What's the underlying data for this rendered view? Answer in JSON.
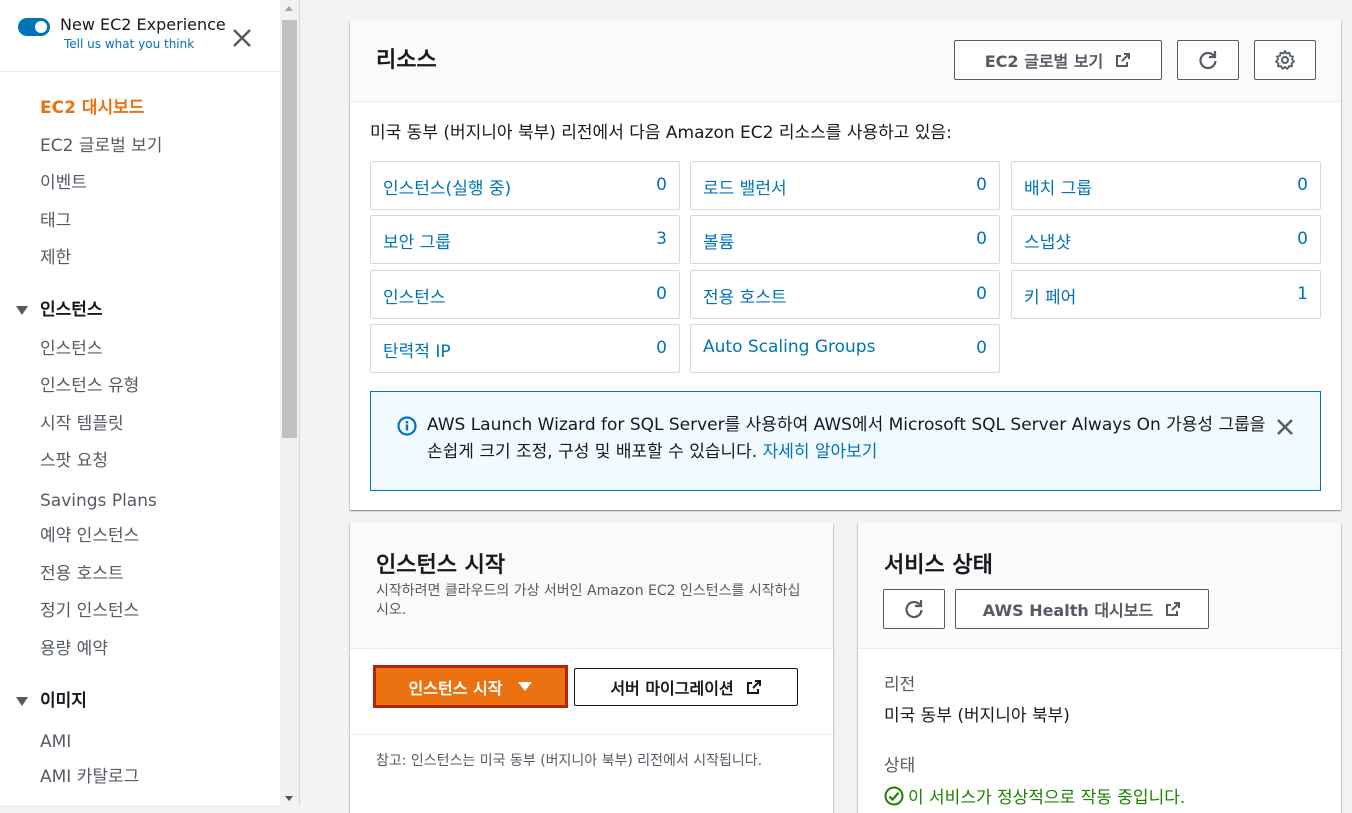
{
  "sidebar": {
    "toggle_title": "New EC2 Experience",
    "toggle_sub": "Tell us what you think",
    "items": [
      {
        "label": "EC2 대시보드"
      },
      {
        "label": "EC2 글로벌 보기"
      },
      {
        "label": "이벤트"
      },
      {
        "label": "태그"
      },
      {
        "label": "제한"
      }
    ],
    "section_instances": "인스턴스",
    "instance_items": [
      {
        "label": "인스턴스"
      },
      {
        "label": "인스턴스 유형"
      },
      {
        "label": "시작 템플릿"
      },
      {
        "label": "스팟 요청"
      },
      {
        "label": "Savings Plans"
      },
      {
        "label": "예약 인스턴스"
      },
      {
        "label": "전용 호스트"
      },
      {
        "label": "정기 인스턴스"
      },
      {
        "label": "용량 예약"
      }
    ],
    "section_images": "이미지",
    "image_items": [
      {
        "label": "AMI"
      },
      {
        "label": "AMI 카탈로그"
      }
    ]
  },
  "resources": {
    "title": "리소스",
    "global_view_label": "EC2 글로벌 보기",
    "description": "미국 동부 (버지니아 북부) 리전에서 다음 Amazon EC2 리소스를 사용하고 있음:",
    "cards": [
      {
        "label": "인스턴스(실행 중)",
        "count": "0"
      },
      {
        "label": "로드 밸런서",
        "count": "0"
      },
      {
        "label": "배치 그룹",
        "count": "0"
      },
      {
        "label": "보안 그룹",
        "count": "3"
      },
      {
        "label": "볼륨",
        "count": "0"
      },
      {
        "label": "스냅샷",
        "count": "0"
      },
      {
        "label": "인스턴스",
        "count": "0"
      },
      {
        "label": "전용 호스트",
        "count": "0"
      },
      {
        "label": "키 페어",
        "count": "1"
      },
      {
        "label": "탄력적 IP",
        "count": "0"
      },
      {
        "label": "Auto Scaling Groups",
        "count": "0"
      }
    ],
    "info_text": "AWS Launch Wizard for SQL Server를 사용하여 AWS에서 Microsoft SQL Server Always On 가용성 그룹을 손쉽게 크기 조정, 구성 및 배포할 수 있습니다.",
    "info_link": "자세히 알아보기"
  },
  "launch": {
    "title": "인스턴스 시작",
    "description": "시작하려면 클라우드의 가상 서버인 Amazon EC2 인스턴스를 시작하십시오.",
    "launch_button": "인스턴스 시작",
    "migrate_button": "서버 마이그레이션",
    "note": "참고: 인스턴스는 미국 동부 (버지니아 북부) 리전에서 시작됩니다."
  },
  "health": {
    "title": "서비스 상태",
    "dashboard_button": "AWS Health 대시보드",
    "region_label": "리전",
    "region_value": "미국 동부 (버지니아 북부)",
    "status_label": "상태",
    "status_value": "이 서비스가 정상적으로 작동 중입니다."
  },
  "colors": {
    "accent_orange": "#ec7211",
    "link_blue": "#0073bb",
    "success_green": "#1d8102"
  }
}
